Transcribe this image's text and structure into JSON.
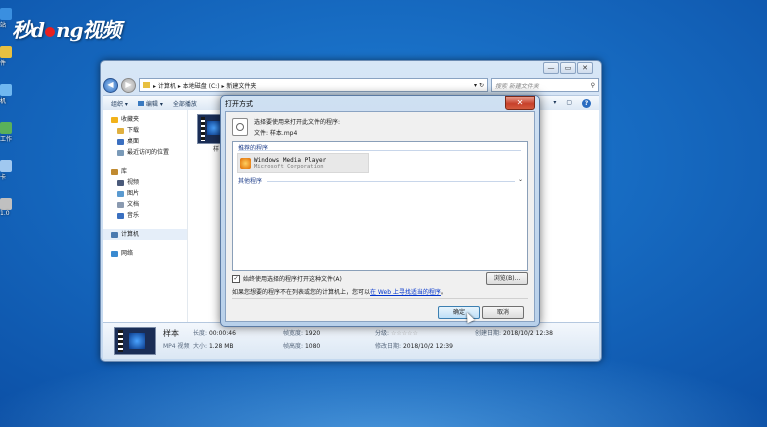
{
  "brand": {
    "logo_pre": "秒",
    "logo_mid": "d",
    "logo_post": "ng视频"
  },
  "desktop": {
    "icons": [
      {
        "label": "站",
        "color": "#3a8fe0"
      },
      {
        "label": "件",
        "color": "#e8c040"
      },
      {
        "label": "机",
        "color": "#6fb7f0"
      },
      {
        "label": "工作",
        "color": "#5ab05a"
      },
      {
        "label": "卡",
        "color": "#a0c8f0"
      },
      {
        "label": "1.0",
        "color": "#c0c0c0"
      }
    ]
  },
  "explorer": {
    "controls": {
      "min": "—",
      "max": "▭",
      "close": "✕"
    },
    "nav": {
      "back": "◀",
      "forward": "▶"
    },
    "address": {
      "path": "▸ 计算机 ▸ 本地磁盘 (C:) ▸ 新建文件夹",
      "refresh": "▾ ↻"
    },
    "search": {
      "placeholder": "搜索 新建文件夹"
    },
    "toolbar": {
      "organize": "组织 ▾",
      "edit": "编辑 ▾",
      "play_all": "全部播放",
      "views": "▾",
      "preview": "▢",
      "help": "?"
    },
    "navpane": [
      {
        "label": "收藏夹",
        "icon": "star-icon",
        "color": "#f2b21a",
        "sub": false,
        "gap": false,
        "selected": false
      },
      {
        "label": "下载",
        "icon": "download-folder-icon",
        "color": "#e0b040",
        "sub": true,
        "gap": false,
        "selected": false
      },
      {
        "label": "桌面",
        "icon": "desktop-icon",
        "color": "#3b6fc0",
        "sub": true,
        "gap": false,
        "selected": false
      },
      {
        "label": "最近访问的位置",
        "icon": "recent-places-icon",
        "color": "#7a9ab8",
        "sub": true,
        "gap": false,
        "selected": false
      },
      {
        "label": "库",
        "icon": "library-icon",
        "color": "#c08a30",
        "sub": false,
        "gap": true,
        "selected": false
      },
      {
        "label": "视频",
        "icon": "video-library-icon",
        "color": "#4a5a7a",
        "sub": true,
        "gap": false,
        "selected": false
      },
      {
        "label": "图片",
        "icon": "pictures-library-icon",
        "color": "#5a9ad0",
        "sub": true,
        "gap": false,
        "selected": false
      },
      {
        "label": "文档",
        "icon": "documents-library-icon",
        "color": "#8a9ab0",
        "sub": true,
        "gap": false,
        "selected": false
      },
      {
        "label": "音乐",
        "icon": "music-library-icon",
        "color": "#3a70c0",
        "sub": true,
        "gap": false,
        "selected": false
      },
      {
        "label": "计算机",
        "icon": "computer-icon",
        "color": "#4a7ab0",
        "sub": false,
        "gap": true,
        "selected": true
      },
      {
        "label": "网络",
        "icon": "network-icon",
        "color": "#3a8ad0",
        "sub": false,
        "gap": true,
        "selected": false
      }
    ],
    "file": {
      "label": "样"
    },
    "details": {
      "name": "样本",
      "type": "MP4 视频",
      "length_label": "长度:",
      "length": "00:00:46",
      "size_label": "大小:",
      "size": "1.28 MB",
      "fw_label": "帧宽度:",
      "fw": "1920",
      "fh_label": "帧高度:",
      "fh": "1080",
      "rating_label": "分级:",
      "rating": "☆☆☆☆☆",
      "modified_label": "修改日期:",
      "modified": "2018/10/2 12:39",
      "created_label": "创建日期:",
      "created": "2018/10/2 12:38"
    }
  },
  "dialog": {
    "title": "打开方式",
    "close": "✕",
    "prompt": "选择要使用来打开此文件的程序:",
    "file_line": "文件:  样本.mp4",
    "recommended": "推荐的程序",
    "program": {
      "name": "Windows Media Player",
      "publisher": "Microsoft Corporation"
    },
    "other": "其他程序",
    "chevron": "⌄",
    "always_checked": "✓",
    "always": "始终使用选择的程序打开这种文件(A)",
    "browse": "浏览(B)...",
    "hint_pre": "如果您想要的程序不在列表或您的计算机上，您可以",
    "hint_link": "在 Web 上寻找适当的程序",
    "hint_post": "。",
    "ok": "确定",
    "cancel": "取消"
  }
}
